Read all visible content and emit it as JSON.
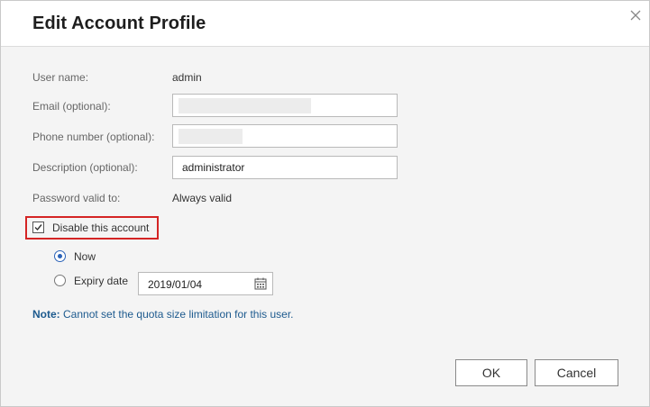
{
  "dialog": {
    "title": "Edit Account Profile"
  },
  "form": {
    "username_label": "User name:",
    "username_value": "admin",
    "email_label": "Email (optional):",
    "email_value": "",
    "phone_label": "Phone number (optional):",
    "phone_value": "",
    "description_label": "Description (optional):",
    "description_value": "administrator",
    "password_label": "Password valid to:",
    "password_value": "Always valid"
  },
  "disable": {
    "label": "Disable this account",
    "checked": true,
    "highlight_color": "#d42424"
  },
  "disable_options": {
    "now_label": "Now",
    "now_selected": true,
    "expiry_label": "Expiry date",
    "expiry_value": "2019/01/04"
  },
  "note": {
    "prefix": "Note:",
    "text": "Cannot set the quota size limitation for this user."
  },
  "buttons": {
    "ok": "OK",
    "cancel": "Cancel"
  },
  "colors": {
    "accent": "#2b63b8",
    "note": "#1d5a8e"
  },
  "icons": {
    "close": "close-icon",
    "calendar": "calendar-icon",
    "checkbox": "checkmark-icon"
  }
}
